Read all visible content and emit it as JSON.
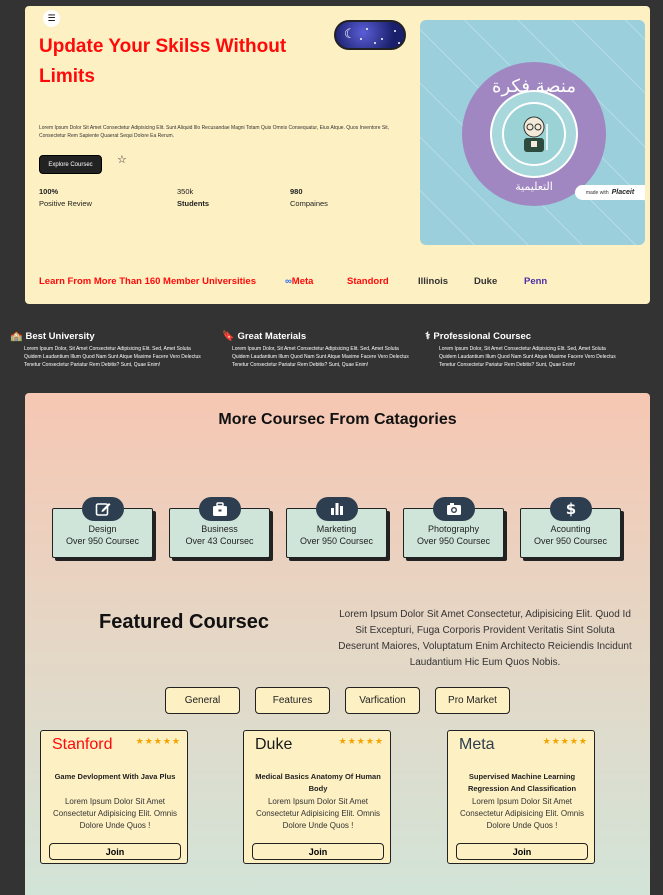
{
  "hero": {
    "menu_icon": "hamburger-icon",
    "title": "Update Your Skilss Without Limits",
    "description": "Lorem Ipsum Dolor Sit Amet Consectetur Adipisicing Elit. Sunt Aliquid Illo Recusandae Magni Totam Quis Omnis Consequatur, Eius Atque. Quos Inventore Sit, Consectetur Rem Sapiente Quaerat Sequi Dolore Ea Rerum.",
    "explore_label": "Explore Coursec",
    "stats": [
      {
        "value": "100%",
        "label": "Positive Review"
      },
      {
        "value": "350k",
        "label": "Students"
      },
      {
        "value": "980",
        "label": "Compaines"
      }
    ],
    "image": {
      "arabic_top": "منصة فكرة",
      "arabic_bottom": "التعليمية",
      "placeit_prefix": "made with",
      "placeit_brand": "Placeit"
    },
    "universities_heading": "Learn From More Than 160 Member Universities",
    "universities": [
      "Meta",
      "Standord",
      "Illinois",
      "Duke",
      "Penn"
    ]
  },
  "features": [
    {
      "icon": "school-icon",
      "title": "Best University",
      "text": "Lorem Ipsum Dolor, Sit Amet Consectetur Adipisicing Elit. Sed, Amet Soluta Quidem Laudantium Illum Quod Nam Sunt Atque Maxime Facere Vero Delectus Tenetur Consectetur Pariatur Rem Debitis? Sunt, Quae Enim!"
    },
    {
      "icon": "bookmark-icon",
      "title": "Great Materials",
      "text": "Lorem Ipsum Dolor, Sit Amet Consectetur Adipisicing Elit. Sed, Amet Soluta Quidem Laudantium Illum Quod Nam Sunt Atque Maxime Facere Vero Delectus Tenetur Consectetur Pariatur Rem Debitis? Sunt, Quae Enim!"
    },
    {
      "icon": "stethoscope-icon",
      "title": "Professional Coursec",
      "text": "Lorem Ipsum Dolor, Sit Amet Consectetur Adipisicing Elit. Sed, Amet Soluta Quidem Laudantium Illum Quod Nam Sunt Atque Maxime Facere Vero Delectus Tenetur Consectetur Pariatur Rem Debitis? Sunt, Quae Enim!"
    }
  ],
  "categories_section": {
    "title": "More Coursec From Catagories",
    "items": [
      {
        "icon": "edit-icon",
        "name": "Design",
        "count": "Over 950 Coursec"
      },
      {
        "icon": "briefcase-icon",
        "name": "Business",
        "count": "Over 43 Coursec"
      },
      {
        "icon": "chart-icon",
        "name": "Marketing",
        "count": "Over 950 Coursec"
      },
      {
        "icon": "camera-icon",
        "name": "Photography",
        "count": "Over 950 Coursec"
      },
      {
        "icon": "dollar-icon",
        "name": "Acounting",
        "count": "Over 950 Coursec"
      }
    ]
  },
  "featured": {
    "title": "Featured Coursec",
    "description": "Lorem Ipsum Dolor Sit Amet Consectetur, Adipisicing Elit. Quod Id Sit Excepturi, Fuga Corporis Provident Veritatis Sint Soluta Deserunt Maiores, Voluptatum Enim Architecto Reiciendis Incidunt Laudantium Hic Eum Quos Nobis.",
    "filters": [
      "General",
      "Features",
      "Varfication",
      "Pro Market"
    ],
    "courses": [
      {
        "provider": "Stanford",
        "color": "#ff0a0a",
        "stars": "★★★★★",
        "title": "Game Devlopment With Java Plus",
        "desc": "Lorem Ipsum Dolor Sit Amet Consectetur Adipisicing Elit. Omnis Dolore Unde Quos !",
        "join": "Join"
      },
      {
        "provider": "Duke",
        "color": "#1a1a1a",
        "stars": "★★★★★",
        "title": "Medical Basics Anatomy Of Human Body",
        "desc": "Lorem Ipsum Dolor Sit Amet Consectetur Adipisicing Elit. Omnis Dolore Unde Quos !",
        "join": "Join"
      },
      {
        "provider": "Meta",
        "color": "#2d3e50",
        "stars": "★★★★★",
        "title": "Supervised Machine Learning Regression And Classification",
        "desc": "Lorem Ipsum Dolor Sit Amet Consectetur Adipisicing Elit. Omnis Dolore Unde Quos !",
        "join": "Join"
      }
    ]
  },
  "colors": {
    "accent_red": "#ff0a0a",
    "cream": "#fdf0c3",
    "dark": "#333333",
    "navy": "#2d3e50",
    "mint": "#cfe5da",
    "star_gold": "#f5a300",
    "penn_purple": "#4b2ea8"
  }
}
